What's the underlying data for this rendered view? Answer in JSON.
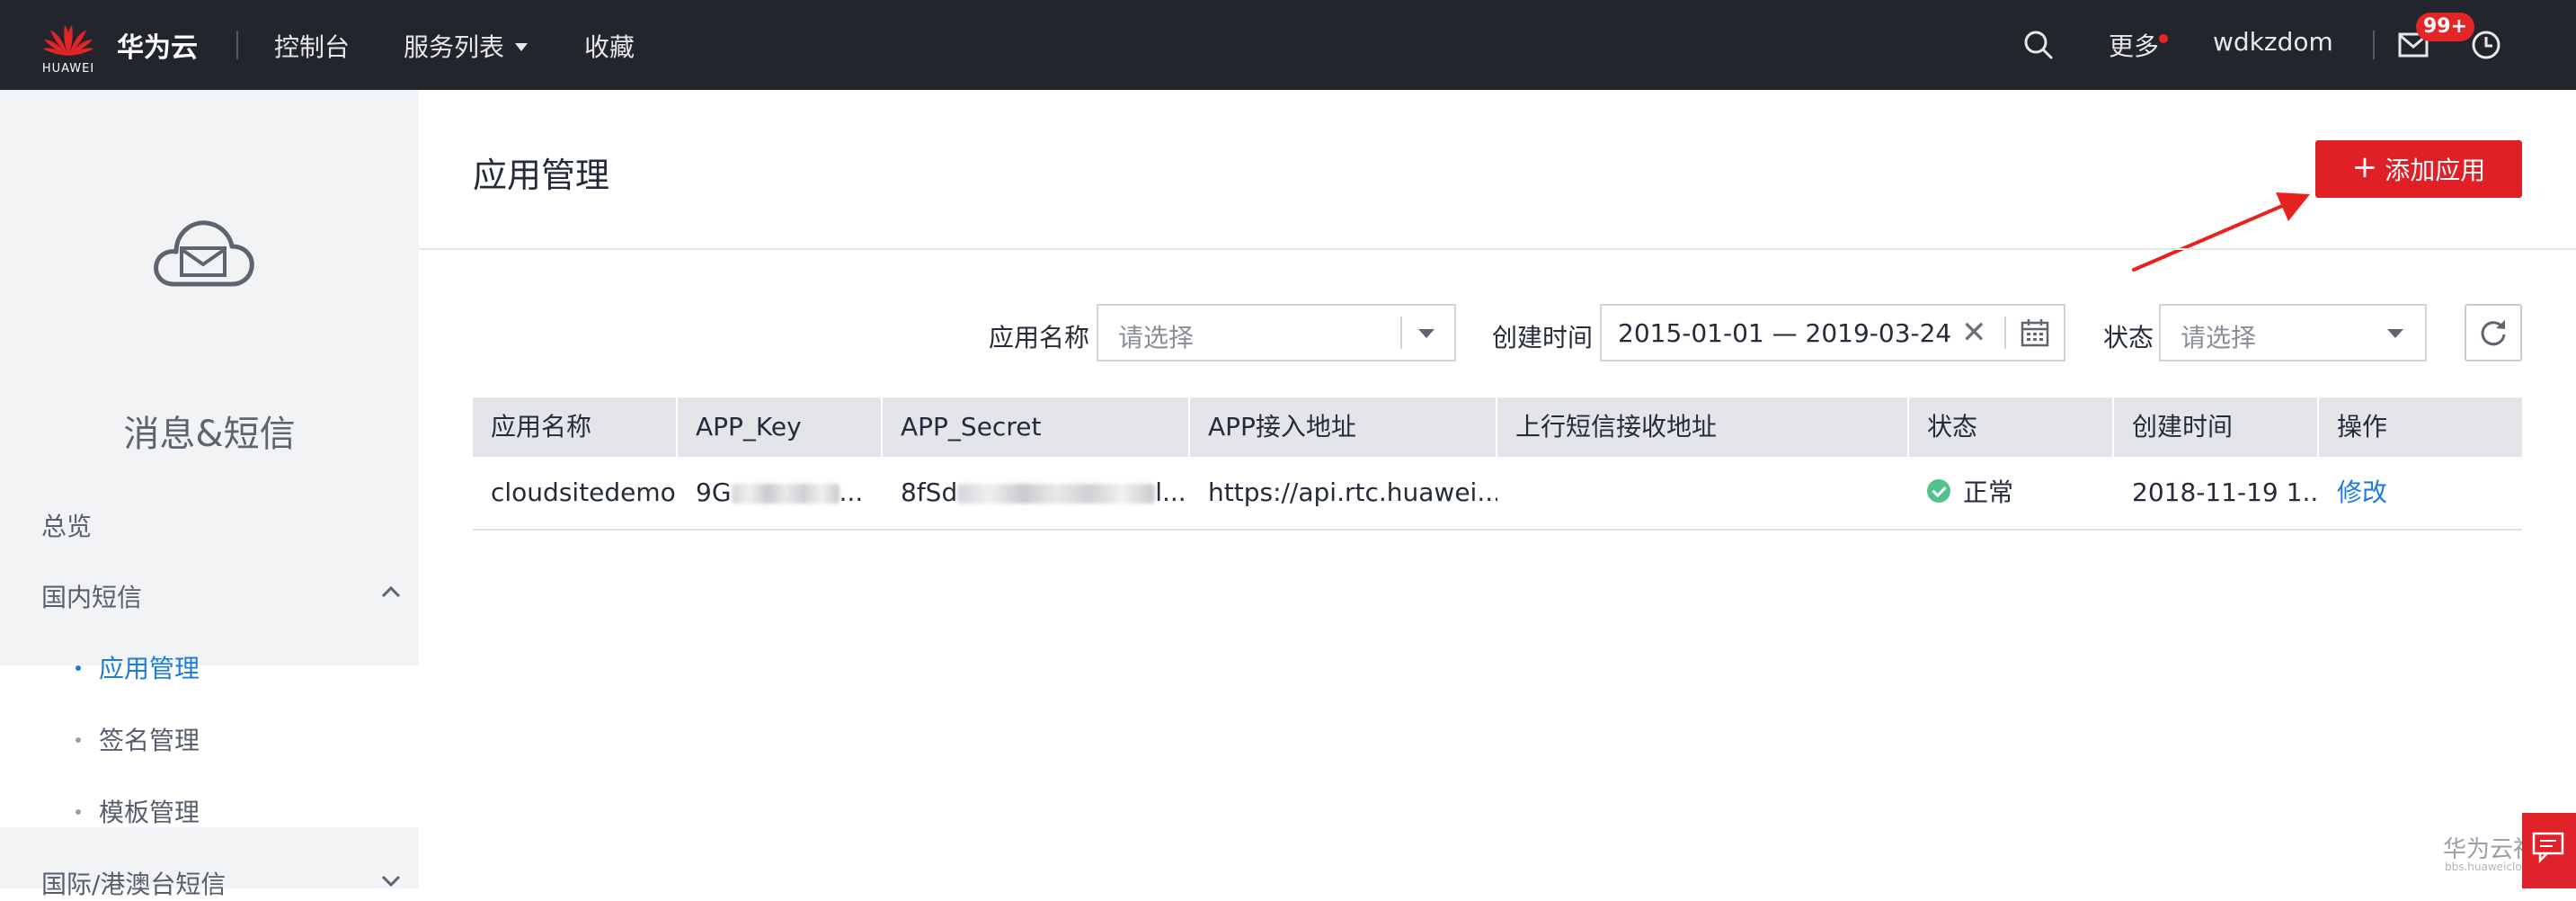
{
  "topnav": {
    "logo_text": "HUAWEI",
    "brand": "华为云",
    "items": [
      "控制台",
      "服务列表",
      "收藏"
    ],
    "more_label": "更多",
    "username": "wdkzdom",
    "message_badge": "99+",
    "icons": [
      "search-icon",
      "mail-icon",
      "clock-icon"
    ]
  },
  "sidebar": {
    "product_name": "消息&短信",
    "overview": "总览",
    "sections": [
      {
        "label": "国内短信",
        "expanded": true,
        "items": [
          {
            "label": "应用管理",
            "active": true
          },
          {
            "label": "签名管理",
            "active": false
          },
          {
            "label": "模板管理",
            "active": false
          }
        ]
      },
      {
        "label": "国际/港澳台短信",
        "expanded": false
      }
    ]
  },
  "main": {
    "title": "应用管理",
    "add_button": "添加应用"
  },
  "filters": {
    "app_name_label": "应用名称",
    "app_name_placeholder": "请选择",
    "created_label": "创建时间",
    "date_range": "2015-01-01 — 2019-03-24",
    "status_label": "状态",
    "status_placeholder": "请选择"
  },
  "table": {
    "columns": [
      "应用名称",
      "APP_Key",
      "APP_Secret",
      "APP接入地址",
      "上行短信接收地址",
      "状态",
      "创建时间",
      "操作"
    ],
    "rows": [
      {
        "app_name": "cloudsitedemo",
        "app_key": "9G",
        "app_key_suffix": "...",
        "app_secret": "8fSd",
        "app_secret_suffix": "l...",
        "access_url": "https://api.rtc.huawei...",
        "uplink_url": "",
        "status": "正常",
        "created": "2018-11-19 1...",
        "action": "修改"
      }
    ]
  },
  "footer": {
    "watermark": "华为云社区",
    "watermark_sub": "bbs.huaweicloud.com"
  },
  "colors": {
    "nav_bg": "#22252b",
    "accent_red": "#e01f26",
    "link_blue": "#1d7bdb",
    "status_green": "#50c28c"
  }
}
